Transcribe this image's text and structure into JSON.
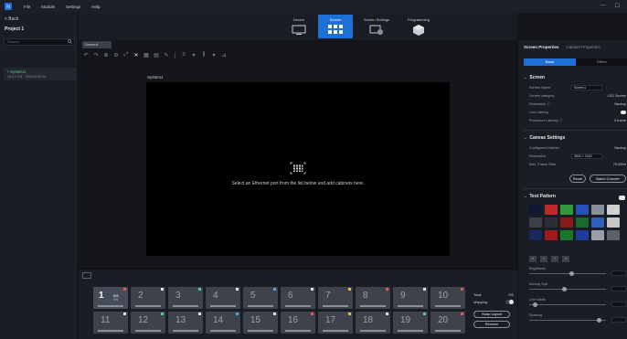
{
  "app": {
    "menu": [
      "File",
      "Module",
      "Settings",
      "Help"
    ],
    "window_controls": [
      "—",
      "☐"
    ]
  },
  "left_panel": {
    "back_label": "< Back",
    "project_title": "Project 1",
    "search_placeholder": "Search",
    "system": {
      "name": "• System1",
      "sub": "10.0.0.101 · 2023.00.00.10"
    }
  },
  "modes": [
    {
      "label": "Device",
      "icon": "monitor-icon",
      "active": false
    },
    {
      "label": "Screen",
      "icon": "grid-icon",
      "active": true
    },
    {
      "label": "Screen Settings",
      "icon": "screen-settings-icon",
      "active": false
    },
    {
      "label": "Programming",
      "icon": "cube-icon",
      "active": false
    }
  ],
  "tab": {
    "label": "Screen1"
  },
  "canvas": {
    "screen_title": "System1",
    "message": "Select an Ethernet port from the list below and add cabinets here."
  },
  "ports": [
    {
      "num": "1",
      "sub": "6/8",
      "sub2": "0%",
      "active": true,
      "dot": "#e05a5a"
    },
    {
      "num": "2",
      "dot": "#e0e0e0"
    },
    {
      "num": "3",
      "dot": "#4fd08a"
    },
    {
      "num": "4",
      "dot": "#e0e0e0"
    },
    {
      "num": "5",
      "dot": "#4fa3e0"
    },
    {
      "num": "6",
      "dot": "#e0e0e0"
    },
    {
      "num": "7",
      "dot": "#e0c04f"
    },
    {
      "num": "8",
      "dot": "#e05a5a"
    },
    {
      "num": "9",
      "dot": "#e0e0e0"
    },
    {
      "num": "10",
      "dot": "#e05a5a"
    },
    {
      "num": "11",
      "dot": "#e0e0e0"
    },
    {
      "num": "12",
      "dot": "#4fd08a"
    },
    {
      "num": "13",
      "dot": "#e0e0e0"
    },
    {
      "num": "14",
      "dot": "#4fa3e0"
    },
    {
      "num": "15",
      "dot": "#e0e0e0"
    },
    {
      "num": "16",
      "dot": "#e05a5a"
    },
    {
      "num": "17",
      "dot": "#e0c04f"
    },
    {
      "num": "18",
      "dot": "#e0e0e0"
    },
    {
      "num": "19",
      "dot": "#4fd08a"
    },
    {
      "num": "20",
      "dot": "#e05a5a"
    }
  ],
  "port_side": {
    "total_label": "Total",
    "total_value": "0/0",
    "mapping_label": "Mapping",
    "btn_swap": "Swap Layout",
    "btn_remove": "Remove"
  },
  "right_panel": {
    "tabs": [
      "Screen Properties",
      "Cabinet Properties"
    ],
    "segments": [
      "Basic",
      "Effect"
    ],
    "screen_section": {
      "title": "Screen",
      "rows": [
        {
          "label": "Screen Name",
          "input": "Screen1"
        },
        {
          "label": "Screen category",
          "value": "LED Screen"
        },
        {
          "label": "Resolution ⓘ",
          "value": "Backup"
        },
        {
          "label": "Low Latency",
          "toggle": true
        },
        {
          "label": "Processor Latency ⓘ",
          "value": "0 frame"
        }
      ]
    },
    "canvas_section": {
      "title": "Canvas Settings",
      "rows": [
        {
          "label": "Configured Cabinet",
          "value": "Backup"
        },
        {
          "label": "Resolution",
          "input": "3840 × 2160"
        },
        {
          "label": "Max. Frame Rate",
          "value": "75.00Hz"
        }
      ],
      "buttons": [
        "Reset",
        "Batch Convert"
      ]
    },
    "test_section": {
      "title": "Test Pattern",
      "colors": [
        "#101830",
        "#c0282a",
        "#2e9a3c",
        "#2850b8",
        "#8a8f9a",
        "#d0d0d0",
        "#3a3f4a",
        "#2a2e38",
        "#8a1a1a",
        "#1a6a30",
        "#3060c0",
        "#c8c8c8",
        "#1a2a60",
        "#a01818",
        "#187828",
        "#1c3c9c",
        "#9aa0ab",
        "#5a606c"
      ],
      "sliders": [
        {
          "label": "Brightness",
          "level": 0.55
        },
        {
          "label": "Moving Spd",
          "level": 0.45
        },
        {
          "label": "Line Width",
          "level": 0.05
        },
        {
          "label": "Spacing",
          "level": 0.92
        }
      ]
    }
  }
}
